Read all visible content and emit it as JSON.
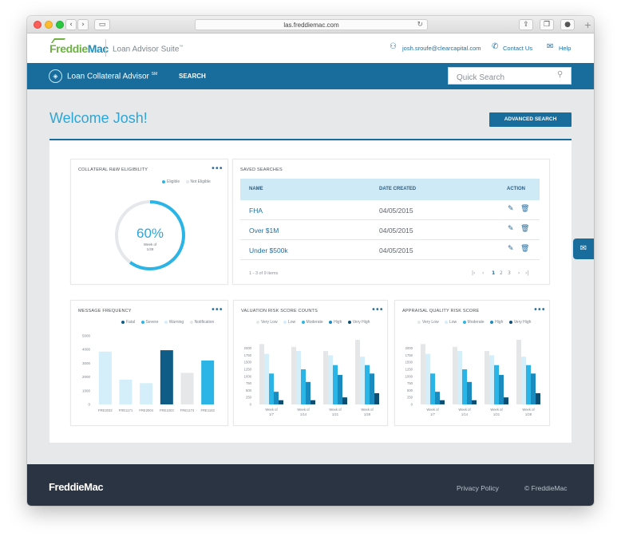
{
  "browser": {
    "url": "las.freddiemac.com",
    "back_glyph": "‹",
    "forward_glyph": "›",
    "sidebar_glyph": "▭",
    "reload_glyph": "↻",
    "share_glyph": "⇪",
    "tabs_glyph": "❐",
    "ext_glyph": "●",
    "newtab_glyph": "+",
    "icons": [
      "chevron-left-icon",
      "chevron-right-icon",
      "sidebar-icon",
      "reload-icon",
      "share-icon",
      "tabs-icon",
      "extension-icon",
      "plus-icon"
    ]
  },
  "header": {
    "logo_part1": "Freddie",
    "logo_part2": "Mac",
    "suite_name": "Loan Advisor Suite",
    "suite_tm": "™",
    "user_email": "josh.sroufe@clearcapital.com",
    "contact_label": "Contact Us",
    "help_label": "Help",
    "user_glyph": "⚇",
    "contact_glyph": "✆",
    "help_glyph": "✉",
    "icons": [
      "user-icon",
      "phone-icon",
      "help-chat-icon"
    ]
  },
  "nav": {
    "product_name": "Loan Collateral Advisor",
    "product_mark": "SM",
    "search_label": "SEARCH",
    "quick_search_placeholder": "Quick Search",
    "logo_glyph": "◈",
    "search_glyph": "⚲",
    "icons": [
      "collateral-advisor-logo-icon",
      "search-icon"
    ]
  },
  "main": {
    "welcome": "Welcome Josh!",
    "advanced_search_label": "ADVANCED SEARCH",
    "chat_glyph": "✉"
  },
  "colors": {
    "brand_blue": "#186d9d",
    "accent_blue": "#2aa7d8",
    "brand_green": "#6cb33f",
    "footer_bg": "#2a3442"
  },
  "eligibility": {
    "title": "COLLATERAL R&W ELIGIBILITY",
    "more_glyph": "•••",
    "legend": [
      {
        "label": "Eligible",
        "color": "#2bb5e6"
      },
      {
        "label": "Not Eligible",
        "color": "#e5e7ea"
      }
    ],
    "percent_value": 0.6,
    "percent_label": "60%",
    "week_line1": "Week of",
    "week_line2": "1/28"
  },
  "saved_searches": {
    "title": "SAVED SEARCHES",
    "columns": [
      "NAME",
      "DATE CREATED",
      "ACTION"
    ],
    "rows": [
      {
        "name": "FHA",
        "date": "04/05/2015"
      },
      {
        "name": "Over $1M",
        "date": "04/05/2015"
      },
      {
        "name": "Under $500k",
        "date": "04/05/2015"
      }
    ],
    "edit_glyph": "✎",
    "delete_glyph": "🗑",
    "count_label": "1 - 3 of 9 items",
    "pager": {
      "first": "|‹",
      "prev": "‹",
      "pages": [
        "1",
        "2",
        "3"
      ],
      "next": "›",
      "last": "›|"
    }
  },
  "message_frequency": {
    "title": "MESSAGE FREQUENCY",
    "more_glyph": "•••",
    "legend": [
      {
        "label": "Fatal",
        "color": "#0f5c86"
      },
      {
        "label": "Severe",
        "color": "#2bb5e6"
      },
      {
        "label": "Warning",
        "color": "#d4eefa"
      },
      {
        "label": "Notification",
        "color": "#e6e7e9"
      }
    ]
  },
  "valuation_risk": {
    "title": "VALUATION RISK SCORE COUNTS",
    "more_glyph": "•••",
    "legend": [
      {
        "label": "Very Low",
        "color": "#e5e6e8"
      },
      {
        "label": "Low",
        "color": "#d4eefa"
      },
      {
        "label": "Moderate",
        "color": "#2bb5e6"
      },
      {
        "label": "High",
        "color": "#1a8abf"
      },
      {
        "label": "Very High",
        "color": "#0f4e73"
      }
    ]
  },
  "appraisal_risk": {
    "title": "APPRAISAL QUALITY RISK SCORE",
    "more_glyph": "•••",
    "legend": [
      {
        "label": "Very Low",
        "color": "#e5e6e8"
      },
      {
        "label": "Low",
        "color": "#d4eefa"
      },
      {
        "label": "Moderate",
        "color": "#2bb5e6"
      },
      {
        "label": "High",
        "color": "#1a8abf"
      },
      {
        "label": "Very High",
        "color": "#0f4e73"
      }
    ]
  },
  "chart_data": [
    {
      "type": "pie",
      "title": "COLLATERAL R&W ELIGIBILITY",
      "categories": [
        "Eligible",
        "Not Eligible"
      ],
      "values": [
        60,
        40
      ]
    },
    {
      "type": "bar",
      "title": "MESSAGE FREQUENCY",
      "categories": [
        "FRE2032",
        "FRE1171",
        "FRE2004",
        "FRE1003",
        "FRE1174",
        "FRE1163"
      ],
      "values": [
        3850,
        1800,
        1550,
        3950,
        2300,
        3200
      ],
      "colors": [
        "#d4eefa",
        "#d4eefa",
        "#d4eefa",
        "#0f5c86",
        "#e6e7e9",
        "#2bb5e6"
      ],
      "ylim": [
        0,
        5000
      ],
      "yticks": [
        0,
        1000,
        2000,
        3000,
        4000,
        5000
      ],
      "grid": false
    },
    {
      "type": "bar",
      "title": "VALUATION RISK SCORE COUNTS",
      "categories": [
        "Week of 1/7",
        "Week of 1/14",
        "Week of 1/21",
        "Week of 1/28"
      ],
      "series": [
        {
          "name": "Very Low",
          "color": "#e5e6e8",
          "values": [
            2150,
            2050,
            1900,
            2300
          ]
        },
        {
          "name": "Low",
          "color": "#d4eefa",
          "values": [
            1800,
            1900,
            1750,
            1700
          ]
        },
        {
          "name": "Moderate",
          "color": "#2bb5e6",
          "values": [
            1100,
            1250,
            1400,
            1400
          ]
        },
        {
          "name": "High",
          "color": "#1a8abf",
          "values": [
            450,
            800,
            1050,
            1100
          ]
        },
        {
          "name": "Very High",
          "color": "#0f4e73",
          "values": [
            150,
            150,
            250,
            400
          ]
        }
      ],
      "ylim": [
        0,
        2500
      ],
      "yticks": [
        0,
        250,
        500,
        750,
        1000,
        1250,
        1500,
        1750,
        2000
      ],
      "grid": false
    },
    {
      "type": "bar",
      "title": "APPRAISAL QUALITY RISK SCORE",
      "categories": [
        "Week of 1/7",
        "Week of 1/14",
        "Week of 1/21",
        "Week of 1/28"
      ],
      "series": [
        {
          "name": "Very Low",
          "color": "#e5e6e8",
          "values": [
            2150,
            2050,
            1900,
            2300
          ]
        },
        {
          "name": "Low",
          "color": "#d4eefa",
          "values": [
            1800,
            1900,
            1750,
            1700
          ]
        },
        {
          "name": "Moderate",
          "color": "#2bb5e6",
          "values": [
            1100,
            1250,
            1400,
            1400
          ]
        },
        {
          "name": "High",
          "color": "#1a8abf",
          "values": [
            450,
            800,
            1050,
            1100
          ]
        },
        {
          "name": "Very High",
          "color": "#0f4e73",
          "values": [
            150,
            150,
            250,
            400
          ]
        }
      ],
      "ylim": [
        0,
        2500
      ],
      "yticks": [
        0,
        250,
        500,
        750,
        1000,
        1250,
        1500,
        1750,
        2000
      ],
      "grid": false
    }
  ],
  "footer": {
    "logo": "FreddieMac",
    "privacy_label": "Privacy Policy",
    "copyright": "© FreddieMac"
  }
}
